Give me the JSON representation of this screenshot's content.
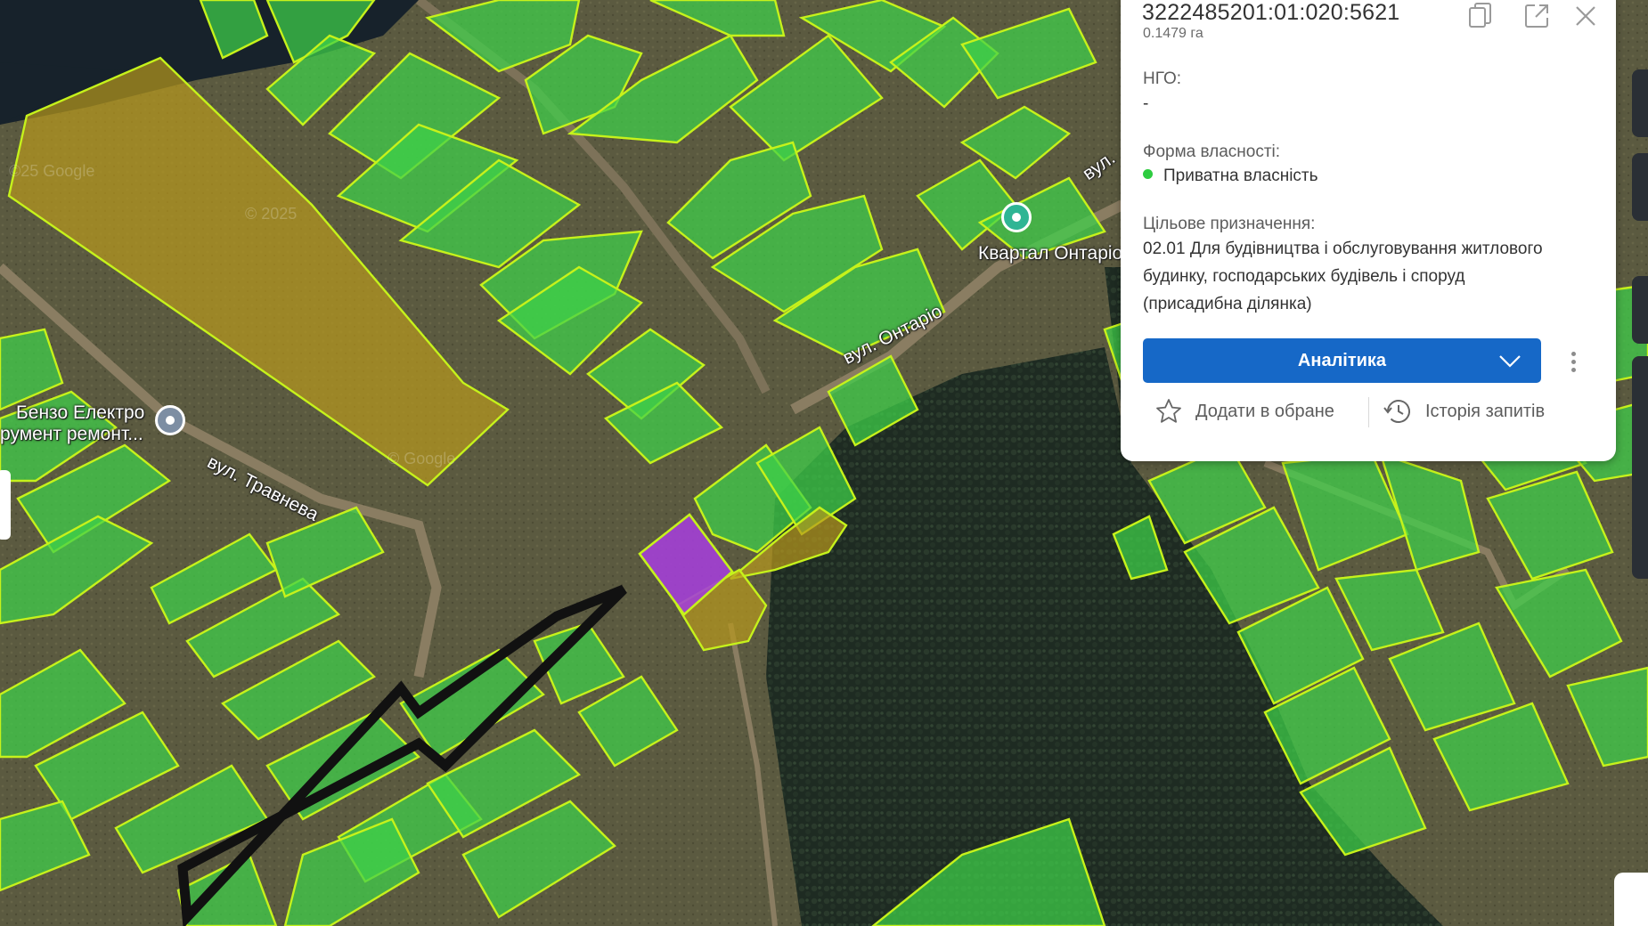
{
  "map": {
    "streets": {
      "travneva": "вул. Травнева",
      "ontario": "вул. Онтаріо",
      "ontario_partial": "вул."
    },
    "poi": {
      "benzo_line1": "Бензо Електро",
      "benzo_line2": "румент ремонт...",
      "kvartal": "Квартал Онтаріо"
    },
    "watermarks": {
      "google": "©25 Google",
      "year": "© 2025",
      "google2": "© Google"
    },
    "colors": {
      "parcel_private": "#3ed14a",
      "parcel_other": "#b8981c",
      "parcel_selected": "#a33fd6",
      "parcel_outline": "#c6f21b"
    },
    "selected_parcel_icon": "arrow-pointer"
  },
  "panel": {
    "cadastral_number": "3222485201:01:020:5621",
    "area": "0.1479 га",
    "ngo_label": "НГО:",
    "ngo_value": "-",
    "ownership_label": "Форма власності:",
    "ownership_value": "Приватна власність",
    "ownership_color": "#2ecc40",
    "purpose_label": "Цільове призначення:",
    "purpose_value": "02.01 Для будівництва і обслуговування житлового будинку, господарських будівель і споруд (присадибна ділянка)",
    "analytics_button": "Аналітика",
    "add_favorite": "Додати в обране",
    "request_history": "Історія запитів",
    "icons": {
      "copy": "copy-icon",
      "open_external": "open-external-icon",
      "close": "close-icon",
      "chevron": "chevron-down-icon",
      "more": "more-vertical-icon",
      "star": "star-icon",
      "history": "history-icon"
    }
  }
}
